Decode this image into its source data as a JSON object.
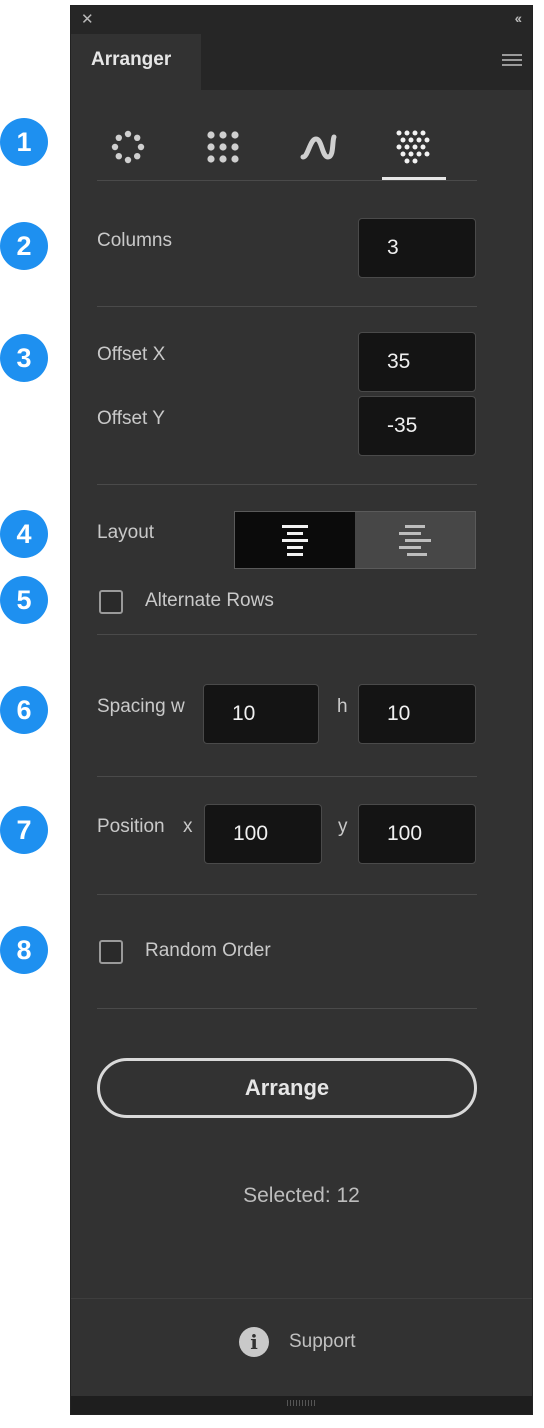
{
  "panel": {
    "title": "Arranger"
  },
  "badges": [
    "1",
    "2",
    "3",
    "4",
    "5",
    "6",
    "7",
    "8"
  ],
  "mode_tabs": {
    "items": [
      "circle-arrange-icon",
      "grid-arrange-icon",
      "wave-arrange-icon",
      "offset-grid-arrange-icon"
    ],
    "active": "offset-grid-arrange-icon"
  },
  "columns": {
    "label": "Columns",
    "value": "3"
  },
  "offset": {
    "x_label": "Offset X",
    "x_value": "35",
    "y_label": "Offset Y",
    "y_value": "-35"
  },
  "layout": {
    "label": "Layout",
    "options": [
      "align-center-icon",
      "align-stagger-icon"
    ],
    "selected": "align-center-icon"
  },
  "alternate_rows": {
    "label": "Alternate Rows",
    "checked": false
  },
  "spacing": {
    "label": "Spacing w",
    "w_value": "10",
    "h_label": "h",
    "h_value": "10"
  },
  "position": {
    "label": "Position",
    "x_label": "x",
    "x_value": "100",
    "y_label": "y",
    "y_value": "100"
  },
  "random_order": {
    "label": "Random Order",
    "checked": false
  },
  "arrange_button": "Arrange",
  "selected_text": "Selected: 12",
  "support": {
    "label": "Support",
    "icon": "info-icon"
  },
  "colors": {
    "badge": "#1e90f0",
    "panel": "#323232",
    "field": "#141414"
  }
}
